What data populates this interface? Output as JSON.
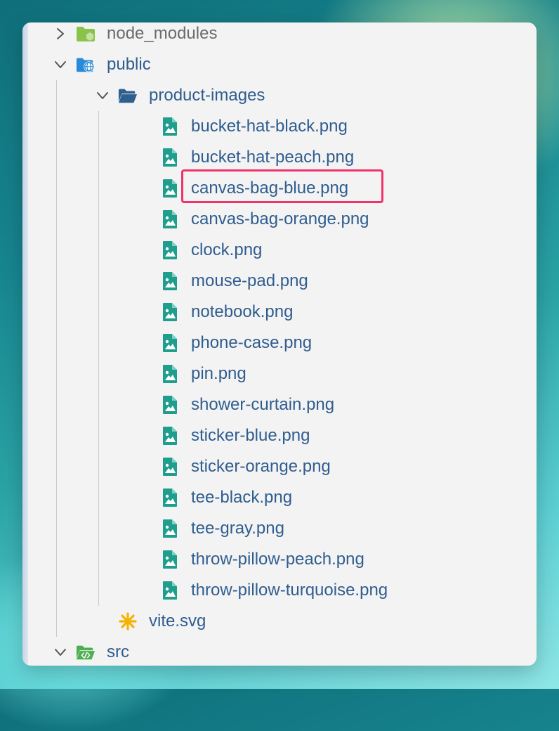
{
  "tree": {
    "node_modules": {
      "label": "node_modules",
      "expanded": false
    },
    "public": {
      "label": "public",
      "expanded": true
    },
    "product_images": {
      "label": "product-images",
      "expanded": true,
      "files": [
        "bucket-hat-black.png",
        "bucket-hat-peach.png",
        "canvas-bag-blue.png",
        "canvas-bag-orange.png",
        "clock.png",
        "mouse-pad.png",
        "notebook.png",
        "phone-case.png",
        "pin.png",
        "shower-curtain.png",
        "sticker-blue.png",
        "sticker-orange.png",
        "tee-black.png",
        "tee-gray.png",
        "throw-pillow-peach.png",
        "throw-pillow-turquoise.png"
      ],
      "highlighted": "canvas-bag-blue.png"
    },
    "vite_svg": {
      "label": "vite.svg"
    },
    "src": {
      "label": "src",
      "expanded": true
    }
  },
  "colors": {
    "label": "#2f5d8f",
    "muted_label": "#6b6b6b",
    "image_icon": "#1f9e8e",
    "folder_blue": "#2f5f8f",
    "public_folder": "#2b8ad8",
    "node_folder": "#8bc34a",
    "vite_icon": "#f5b300",
    "highlight": "#f0336b"
  }
}
